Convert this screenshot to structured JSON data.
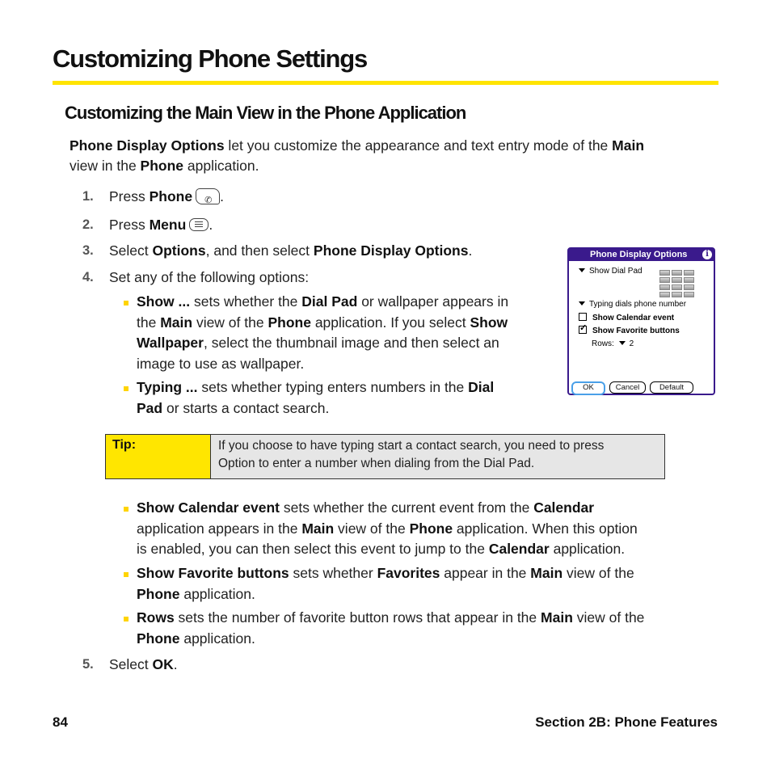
{
  "page": {
    "title": "Customizing Phone Settings",
    "section_title": "Customizing the Main View in the Phone Application",
    "accent_color": "#ffe400"
  },
  "intro": {
    "b1": "Phone Display Options",
    "t1": " let you customize the appearance and text entry mode of the ",
    "b2": "Main",
    "t2": " view in the ",
    "b3": "Phone",
    "t3": " application."
  },
  "steps": [
    {
      "num": "1.",
      "t1": "Press ",
      "b1": "Phone",
      "icon": "phone-key-icon",
      "t2": "."
    },
    {
      "num": "2.",
      "t1": "Press ",
      "b1": "Menu",
      "icon": "menu-key-icon",
      "t2": "."
    },
    {
      "num": "3.",
      "t1": "Select ",
      "b1": "Options",
      "t2": ", and then select ",
      "b2": "Phone Display Options",
      "t3": "."
    },
    {
      "num": "4.",
      "t1": "Set any of the following options:"
    },
    {
      "num": "5.",
      "t1": "Select ",
      "b1": "OK",
      "t2": "."
    }
  ],
  "bullets": [
    {
      "l1": {
        "b1": "Show ...",
        "t1": " sets whether the ",
        "b2": "Dial Pad",
        "t2": " or wallpaper appears in"
      },
      "l2": {
        "t1": "the ",
        "b1": "Main",
        "t2": " view of the ",
        "b2": "Phone",
        "t3": " application. If you select ",
        "b3": "Show"
      },
      "l3": {
        "b1": "Wallpaper",
        "t1": ", select the thumbnail image and then select an"
      },
      "l4": {
        "t1": "image to use as wallpaper."
      }
    },
    {
      "l1": {
        "b1": "Typing ...",
        "t1": " sets whether typing enters numbers in the ",
        "b2": "Dial"
      },
      "l2": {
        "b1": "Pad",
        "t1": " or starts a contact search."
      }
    },
    {
      "l1": {
        "b1": "Show Calendar event",
        "t1": " sets whether the current event from the ",
        "b2": "Calendar"
      },
      "l2": {
        "t1": "application appears in the ",
        "b1": "Main",
        "t2": " view of the ",
        "b2": "Phone",
        "t3": " application. When this option"
      },
      "l3": {
        "t1": "is enabled, you can then select this event to jump to the ",
        "b1": "Calendar",
        "t2": " application."
      }
    },
    {
      "l1": {
        "b1": "Show Favorite buttons",
        "t1": " sets whether ",
        "b2": "Favorites",
        "t2": " appear in the ",
        "b3": "Main",
        "t3": " view of the"
      },
      "l2": {
        "b1": "Phone",
        "t1": " application."
      }
    },
    {
      "l1": {
        "b1": "Rows",
        "t1": " sets the number of favorite button rows that appear in the ",
        "b2": "Main",
        "t2": " view of the"
      },
      "l2": {
        "b1": "Phone",
        "t1": " application."
      }
    }
  ],
  "tip": {
    "label": "Tip:",
    "line1": "If you choose to have typing start a contact search, you need to press",
    "line2": "Option to enter a number when dialing from the Dial Pad."
  },
  "dialog": {
    "title": "Phone Display Options",
    "title_color": "#3a1a8c",
    "info_icon": "i",
    "show_option": "Show Dial Pad",
    "typing_option": "Typing dials phone number",
    "show_calendar_label": "Show Calendar event",
    "show_calendar_checked": false,
    "show_favorites_label": "Show Favorite buttons",
    "show_favorites_checked": true,
    "rows_label": "Rows:",
    "rows_value": "2",
    "buttons": {
      "ok": "OK",
      "cancel": "Cancel",
      "default": "Default"
    }
  },
  "footer": {
    "page_number": "84",
    "section": "Section 2B: Phone Features"
  }
}
